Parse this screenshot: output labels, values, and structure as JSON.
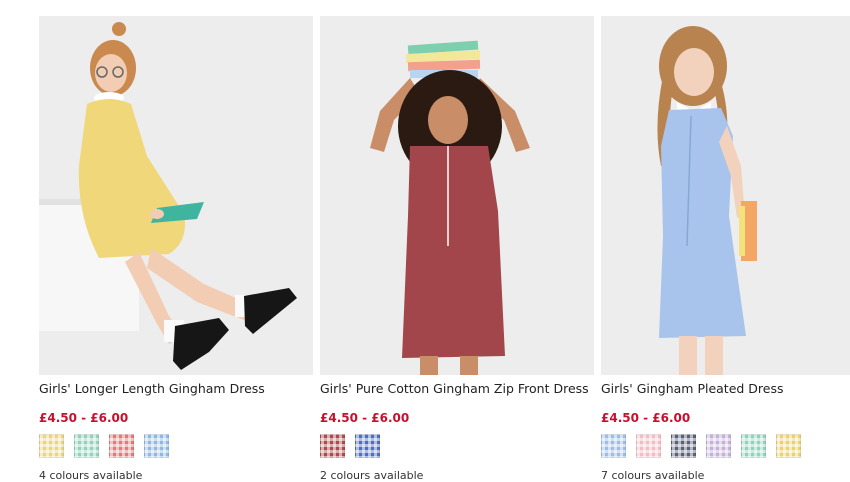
{
  "products": [
    {
      "title": "Girls' Longer Length Gingham Dress",
      "price": "£4.50 - £6.00",
      "colours_text": "4 colours available",
      "dress_color": "#efd77a",
      "swatches": [
        {
          "name": "yellow",
          "color": "#ead57a"
        },
        {
          "name": "green",
          "color": "#8fd3bd"
        },
        {
          "name": "red",
          "color": "#e27a7a"
        },
        {
          "name": "blue",
          "color": "#8fb8e6"
        }
      ]
    },
    {
      "title": "Girls' Pure Cotton Gingham Zip Front Dress",
      "price": "£4.50 - £6.00",
      "colours_text": "2 colours available",
      "dress_color": "#a3464c",
      "swatches": [
        {
          "name": "red",
          "color": "#b3484c"
        },
        {
          "name": "blue",
          "color": "#4d6fbf"
        }
      ]
    },
    {
      "title": "Girls' Gingham Pleated Dress",
      "price": "£4.50 - £6.00",
      "colours_text": "7 colours available",
      "dress_color": "#a9c4ec",
      "swatches": [
        {
          "name": "blue",
          "color": "#9dbde8"
        },
        {
          "name": "pink",
          "color": "#f6bcc6"
        },
        {
          "name": "navy",
          "color": "#5a6278"
        },
        {
          "name": "lilac",
          "color": "#c3b1da"
        },
        {
          "name": "green",
          "color": "#8fd3bd"
        },
        {
          "name": "yellow",
          "color": "#ecd267"
        }
      ]
    }
  ]
}
